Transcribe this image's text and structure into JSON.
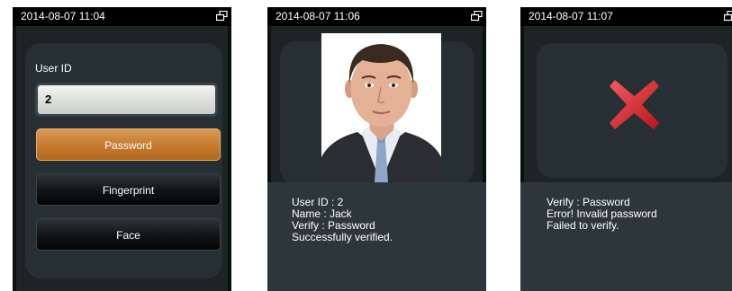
{
  "screens": [
    {
      "time": "2014-08-07 11:04",
      "user_id_label": "User ID",
      "user_id_value": "2",
      "buttons": [
        "Password",
        "Fingerprint",
        "Face"
      ]
    },
    {
      "time": "2014-08-07 11:06",
      "info": [
        "User ID : 2",
        "Name : Jack",
        "Verify : Password",
        "Successfully verified."
      ]
    },
    {
      "time": "2014-08-07 11:07",
      "info": [
        "Verify : Password",
        "Error! Invalid password",
        "Failed to verify."
      ]
    }
  ],
  "icons": {
    "status": "network-icon",
    "error": "red-x-icon",
    "photo": "user-photo"
  },
  "colors": {
    "accent_orange": "#c57a2d",
    "error_red": "#d7262b",
    "status_bar": "#000000"
  }
}
